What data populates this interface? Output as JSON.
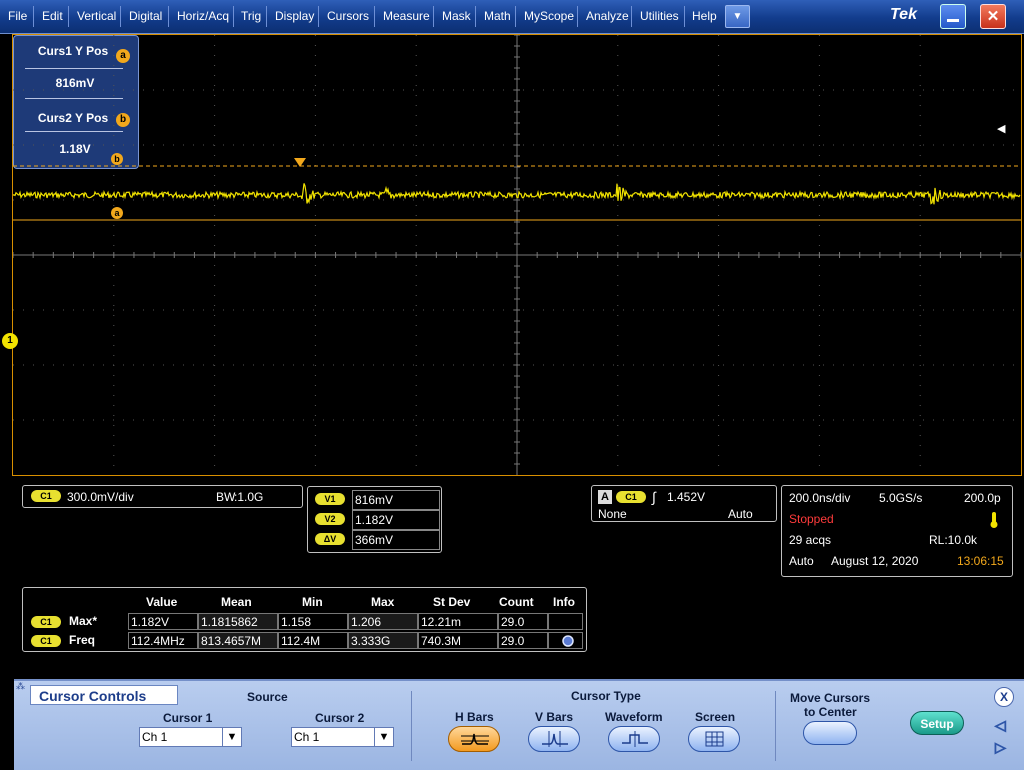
{
  "menu": {
    "items": [
      "File",
      "Edit",
      "Vertical",
      "Digital",
      "Horiz/Acq",
      "Trig",
      "Display",
      "Cursors",
      "Measure",
      "Mask",
      "Math",
      "MyScope",
      "Analyze",
      "Utilities",
      "Help"
    ],
    "brand": "Tek"
  },
  "colors": {
    "trace": "#f2e300",
    "cursor": "#f2a81c",
    "graticule_border": "#d88f00"
  },
  "cursor_readout": {
    "curs1_label": "Curs1 Y Pos",
    "curs1_badge": "a",
    "curs1_value": "816mV",
    "curs2_label": "Curs2 Y Pos",
    "curs2_badge": "b",
    "curs2_value": "1.18V"
  },
  "markers": {
    "channel": "1",
    "cursor_a": "a",
    "cursor_b": "b"
  },
  "channel_box": {
    "ch": "C1",
    "scale": "300.0mV/div",
    "bw_label": "BW",
    "bw_value": ":1.0G"
  },
  "cursor_values": {
    "v1_label": "V1",
    "v1": "816mV",
    "v2_label": "V2",
    "v2": "1.182V",
    "dv_label": "ΔV",
    "dv": "366mV"
  },
  "trigger": {
    "mode_badge": "A",
    "ch": "C1",
    "level": "1.452V",
    "coupling": "None",
    "sweep": "Auto"
  },
  "acquisition": {
    "timebase": "200.0ns/div",
    "sample_rate": "5.0GS/s",
    "resolution": "200.0p",
    "state": "Stopped",
    "acqs": "29 acqs",
    "record_length": "RL:10.0k",
    "mode": "Auto",
    "date": "August 12, 2020",
    "time": "13:06:15"
  },
  "measurements": {
    "headers": [
      "Value",
      "Mean",
      "Min",
      "Max",
      "St Dev",
      "Count",
      "Info"
    ],
    "rows": [
      {
        "ch": "C1",
        "name": "Max*",
        "cells": [
          "1.182V",
          "1.1815862",
          "1.158",
          "1.206",
          "12.21m",
          "29.0",
          ""
        ]
      },
      {
        "ch": "C1",
        "name": "Freq",
        "cells": [
          "112.4MHz",
          "813.4657M",
          "112.4M",
          "3.333G",
          "740.3M",
          "29.0",
          ""
        ]
      }
    ]
  },
  "panel": {
    "title": "Cursor Controls",
    "source_label": "Source",
    "cursor1_label": "Cursor 1",
    "cursor1_value": "Ch 1",
    "cursor2_label": "Cursor 2",
    "cursor2_value": "Ch 1",
    "cursor_type_label": "Cursor Type",
    "types": [
      "H Bars",
      "V Bars",
      "Waveform",
      "Screen"
    ],
    "active_type": "H Bars",
    "move_label_1": "Move Cursors",
    "move_label_2": "to Center",
    "setup_label": "Setup",
    "close_label": "X"
  }
}
